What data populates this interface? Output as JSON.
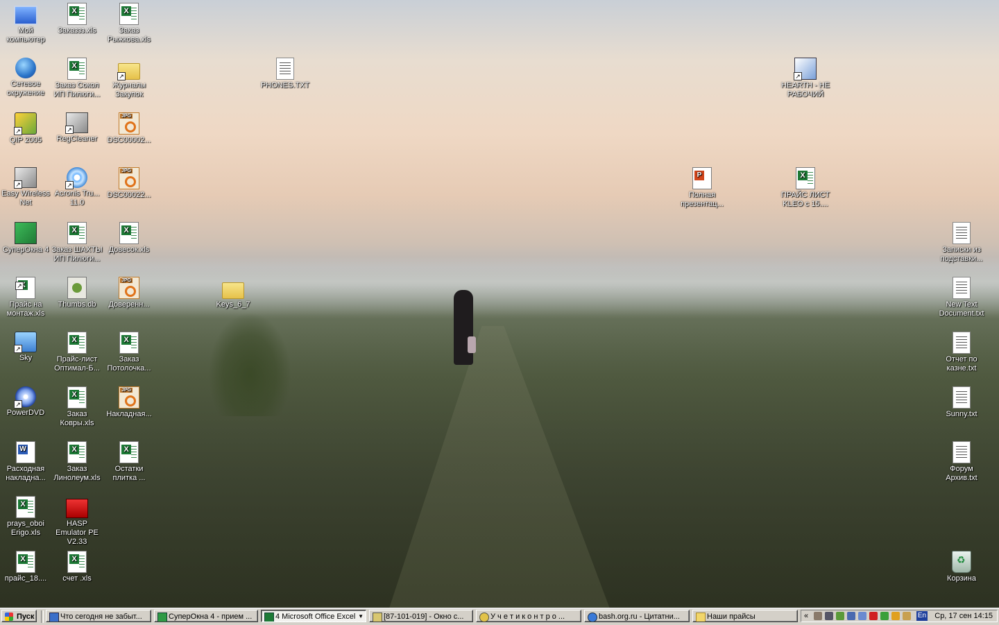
{
  "desktop_icons": [
    {
      "label": "Мой компьютер"
    },
    {
      "label": "Заказзз.xls"
    },
    {
      "label": "Заказ Рыжкова.xls"
    },
    {
      "label": "Сетевое окружение"
    },
    {
      "label": "Заказ Сокол ИП Пилюги..."
    },
    {
      "label": "Журналы Закупок"
    },
    {
      "label": "PHONES.TXT"
    },
    {
      "label": "HEARTH - НЕ РАБОЧИЙ"
    },
    {
      "label": "QIP 2005"
    },
    {
      "label": "RegCleaner"
    },
    {
      "label": "DSC00002..."
    },
    {
      "label": "Easy Wireless Net"
    },
    {
      "label": "Acronis Tru... 11.0"
    },
    {
      "label": "DSC00022..."
    },
    {
      "label": "Полная презентац..."
    },
    {
      "label": "ПРАЙС ЛИСТ KLEO с 15...."
    },
    {
      "label": "СуперОкна 4"
    },
    {
      "label": "Заказ ШАХТЫ ИП Пилюги..."
    },
    {
      "label": "Довесок.xls"
    },
    {
      "label": "Записки из подставки..."
    },
    {
      "label": "Прайс на монтаж.xls"
    },
    {
      "label": "Thumbs.db"
    },
    {
      "label": "Доверенн..."
    },
    {
      "label": "Keys_6_7"
    },
    {
      "label": "New Text Document.txt"
    },
    {
      "label": "Sky"
    },
    {
      "label": "Прайс-лист Оптимал-Б..."
    },
    {
      "label": "Заказ Потолочка..."
    },
    {
      "label": "Отчет по казне.txt"
    },
    {
      "label": "PowerDVD"
    },
    {
      "label": "Заказ Ковры.xls"
    },
    {
      "label": "Накладная..."
    },
    {
      "label": "Sunny.txt"
    },
    {
      "label": "Расходная накладна..."
    },
    {
      "label": "Заказ Линолеум.xls"
    },
    {
      "label": "Остатки плитка ..."
    },
    {
      "label": "Форум Архив.txt"
    },
    {
      "label": "prays_oboi Erigo.xls"
    },
    {
      "label": "HASP Emulator PE V2.33"
    },
    {
      "label": "прайс_18...."
    },
    {
      "label": "счет .xls"
    },
    {
      "label": "Корзина"
    }
  ],
  "taskbar": {
    "start_label": "Пуск",
    "buttons": [
      {
        "label": "Что сегодня не забыт..."
      },
      {
        "label": "СуперОкна 4 - прием ..."
      },
      {
        "label": "4 Microsoft Office Excel"
      },
      {
        "label": "[87-101-019] - Окно с..."
      },
      {
        "label": "У ч е т   и   к о н т р о ..."
      },
      {
        "label": "bash.org.ru - Цитатни..."
      },
      {
        "label": "Наши прайсы"
      }
    ],
    "tray": {
      "chevron": "«",
      "language": "En",
      "clock": "Ср, 17 сен  14:15"
    }
  }
}
